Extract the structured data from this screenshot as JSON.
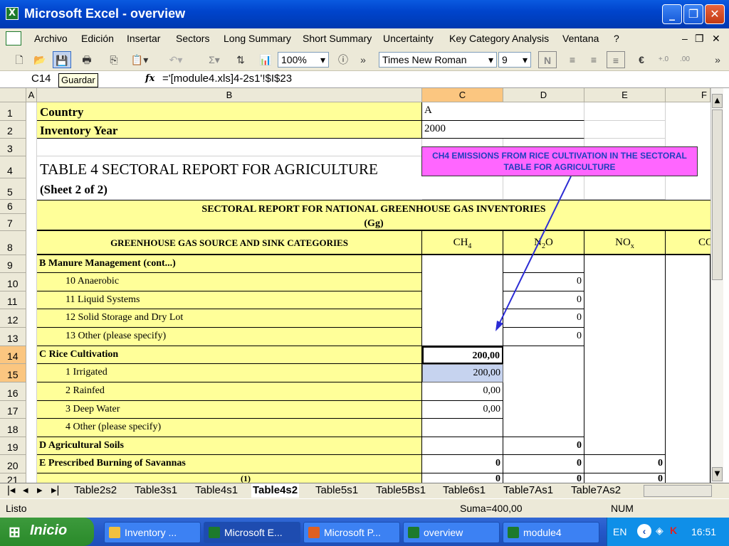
{
  "window": {
    "title": "Microsoft Excel - overview",
    "app_icon": "excel-icon"
  },
  "menu": [
    "Archivo",
    "Edición",
    "Insertar",
    "Sectors",
    "Long Summary",
    "Short Summary",
    "Uncertainty",
    "Key Category Analysis",
    "Ventana",
    "?"
  ],
  "toolbar": {
    "zoom": "100%",
    "font": "Times New Roman",
    "font_size": "9",
    "currency_symbol": "€"
  },
  "formula_bar": {
    "cell_ref": "C14",
    "tooltip": "Guardar",
    "fx": "fx",
    "formula": "='[module4.xls]4-2s1'!$I$23"
  },
  "columns": [
    "A",
    "B",
    "C",
    "D",
    "E",
    "F"
  ],
  "rows": {
    "r1": {
      "num": "1",
      "b": "Country",
      "c": "A"
    },
    "r2": {
      "num": "2",
      "b": "Inventory Year",
      "c": "2000"
    },
    "r3": {
      "num": "3"
    },
    "r4": {
      "num": "4",
      "b": "TABLE 4 SECTORAL REPORT FOR AGRICULTURE"
    },
    "r5": {
      "num": "5",
      "b": "(Sheet 2 of 2)"
    },
    "r6": {
      "num": "6",
      "header": "SECTORAL REPORT FOR NATIONAL GREENHOUSE GAS INVENTORIES"
    },
    "r7": {
      "num": "7",
      "header_units": "(Gg)"
    },
    "r8": {
      "num": "8",
      "b": "GREENHOUSE GAS SOURCE AND SINK CATEGORIES",
      "c_main": "CH",
      "c_sub": "4",
      "d_main": "N",
      "d_sub": "2",
      "d_tail": "O",
      "e_main": "NO",
      "e_sub": "x",
      "f": "CO"
    },
    "r9": {
      "num": "9",
      "b": "B  Manure Management (cont...)"
    },
    "r10": {
      "num": "10",
      "b": "10  Anaerobic",
      "d": "0"
    },
    "r11": {
      "num": "11",
      "b": "11  Liquid Systems",
      "d": "0"
    },
    "r12": {
      "num": "12",
      "b": "12  Solid Storage and Dry Lot",
      "d": "0"
    },
    "r13": {
      "num": "13",
      "b": "13  Other (please specify)",
      "d": "0"
    },
    "r14": {
      "num": "14",
      "b": "C  Rice Cultivation",
      "c": "200,00"
    },
    "r15": {
      "num": "15",
      "b": "1  Irrigated",
      "c": "200,00"
    },
    "r16": {
      "num": "16",
      "b": "2  Rainfed",
      "c": "0,00"
    },
    "r17": {
      "num": "17",
      "b": "3  Deep Water",
      "c": "0,00"
    },
    "r18": {
      "num": "18",
      "b": "4  Other (please specify)"
    },
    "r19": {
      "num": "19",
      "b": "D  Agricultural Soils",
      "d": "0"
    },
    "r20": {
      "num": "20",
      "b": "E  Prescribed Burning of Savannas",
      "c": "0",
      "d": "0",
      "e": "0"
    },
    "r21": {
      "num": "21",
      "b": "(1)",
      "c": "0",
      "d": "0",
      "e": "0"
    }
  },
  "callout": {
    "text": "CH4 EMISSIONS FROM RICE  CULTIVATION IN THE SECTORAL TABLE FOR AGRICULTURE",
    "color": "#ff66ff"
  },
  "sheet_tabs": [
    "Table2s2",
    "Table3s1",
    "Table4s1",
    "Table4s2",
    "Table5s1",
    "Table5Bs1",
    "Table6s1",
    "Table7As1",
    "Table7As2"
  ],
  "active_sheet": "Table4s2",
  "status": {
    "left": "Listo",
    "sum": "Suma=400,00",
    "mode": "NUM"
  },
  "taskbar": {
    "start": "Inicio",
    "tasks": [
      "Inventory ...",
      "Microsoft E...",
      "Microsoft P...",
      "overview",
      "module4"
    ],
    "lang": "EN",
    "clock": "16:51"
  }
}
